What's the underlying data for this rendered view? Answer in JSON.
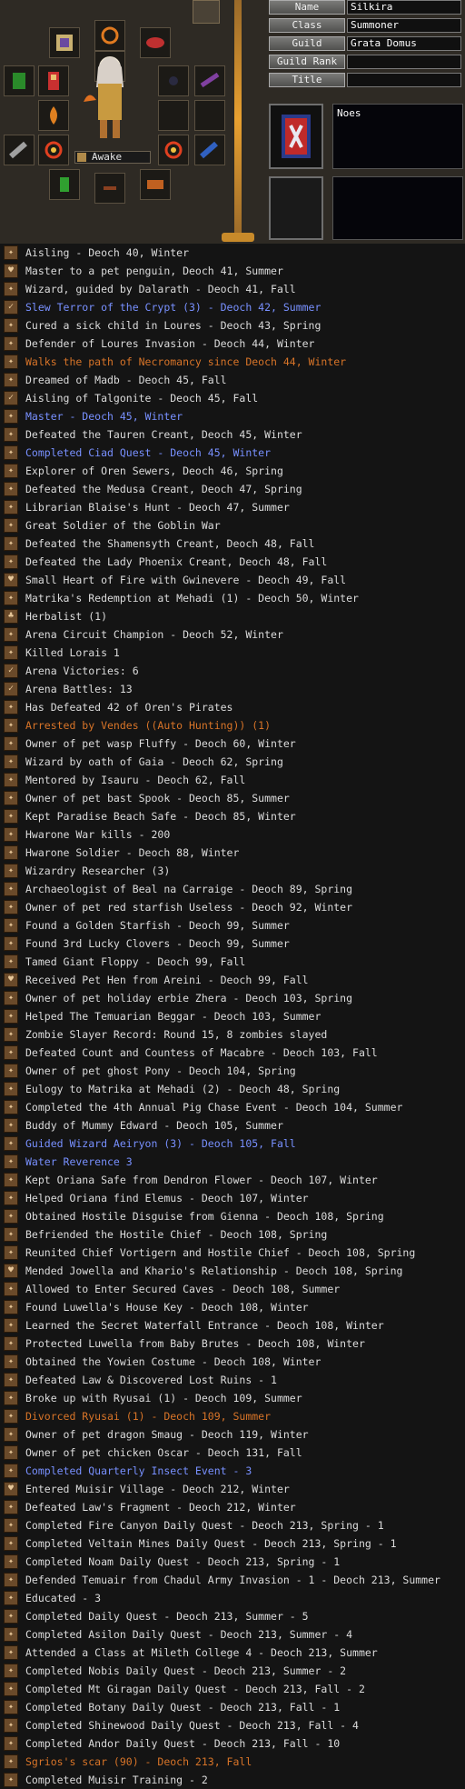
{
  "character": {
    "status_label": "Awake",
    "stats": [
      {
        "label": "Name",
        "value": "Silkira"
      },
      {
        "label": "Class",
        "value": "Summoner"
      },
      {
        "label": "Guild",
        "value": "Grata Domus"
      },
      {
        "label": "Guild Rank",
        "value": ""
      },
      {
        "label": "Title",
        "value": ""
      }
    ],
    "description": "Noes"
  },
  "colors": {
    "normal": "#dcdcdc",
    "blue": "#7890ff",
    "orange": "#d87428"
  },
  "legends": [
    {
      "icon": "legend-icon",
      "color": "normal",
      "text": "Aisling - Deoch 40, Winter"
    },
    {
      "icon": "heart-icon",
      "color": "normal",
      "text": "Master to a pet penguin, Deoch 41, Summer"
    },
    {
      "icon": "legend-icon",
      "color": "normal",
      "text": "Wizard, guided by Dalarath - Deoch 41, Fall"
    },
    {
      "icon": "check-icon",
      "color": "blue",
      "text": "Slew Terror of the Crypt (3) - Deoch 42, Summer"
    },
    {
      "icon": "legend-icon",
      "color": "normal",
      "text": "Cured a sick child in Loures - Deoch 43, Spring"
    },
    {
      "icon": "legend-icon",
      "color": "normal",
      "text": "Defender of Loures Invasion - Deoch 44, Winter"
    },
    {
      "icon": "legend-icon",
      "color": "orange",
      "text": "Walks the path of Necromancy since Deoch 44, Winter"
    },
    {
      "icon": "legend-icon",
      "color": "normal",
      "text": "Dreamed of Madb - Deoch 45, Fall"
    },
    {
      "icon": "check-icon",
      "color": "normal",
      "text": "Aisling of Talgonite - Deoch 45, Fall"
    },
    {
      "icon": "legend-icon",
      "color": "blue",
      "text": "Master - Deoch 45, Winter"
    },
    {
      "icon": "legend-icon",
      "color": "normal",
      "text": "Defeated the Tauren Creant, Deoch 45, Winter"
    },
    {
      "icon": "legend-icon",
      "color": "blue",
      "text": "Completed Ciad Quest - Deoch 45, Winter"
    },
    {
      "icon": "legend-icon",
      "color": "normal",
      "text": "Explorer of Oren Sewers, Deoch 46, Spring"
    },
    {
      "icon": "legend-icon",
      "color": "normal",
      "text": "Defeated the Medusa Creant, Deoch 47, Spring"
    },
    {
      "icon": "legend-icon",
      "color": "normal",
      "text": "Librarian Blaise's Hunt - Deoch 47, Summer"
    },
    {
      "icon": "legend-icon",
      "color": "normal",
      "text": "Great Soldier of the Goblin War"
    },
    {
      "icon": "legend-icon",
      "color": "normal",
      "text": "Defeated the Shamensyth Creant, Deoch 48, Fall"
    },
    {
      "icon": "legend-icon",
      "color": "normal",
      "text": "Defeated the Lady Phoenix Creant, Deoch 48, Fall"
    },
    {
      "icon": "heart-icon",
      "color": "normal",
      "text": "Small Heart of Fire with Gwinevere - Deoch 49, Fall"
    },
    {
      "icon": "legend-icon",
      "color": "normal",
      "text": "Matrika's Redemption at Mehadi (1) - Deoch 50, Winter"
    },
    {
      "icon": "herb-icon",
      "color": "normal",
      "text": "Herbalist (1)"
    },
    {
      "icon": "legend-icon",
      "color": "normal",
      "text": "Arena Circuit Champion - Deoch 52, Winter"
    },
    {
      "icon": "legend-icon",
      "color": "normal",
      "text": "Killed Lorais 1"
    },
    {
      "icon": "check-icon",
      "color": "normal",
      "text": "Arena Victories: 6"
    },
    {
      "icon": "check-icon",
      "color": "normal",
      "text": "Arena Battles: 13"
    },
    {
      "icon": "legend-icon",
      "color": "normal",
      "text": "Has Defeated 42 of Oren's Pirates"
    },
    {
      "icon": "legend-icon",
      "color": "orange",
      "text": "Arrested by Vendes ((Auto Hunting)) (1)"
    },
    {
      "icon": "legend-icon",
      "color": "normal",
      "text": "Owner of pet wasp Fluffy - Deoch 60, Winter"
    },
    {
      "icon": "legend-icon",
      "color": "normal",
      "text": "Wizard by oath of Gaia - Deoch 62, Spring"
    },
    {
      "icon": "legend-icon",
      "color": "normal",
      "text": "Mentored by Isauru - Deoch 62, Fall"
    },
    {
      "icon": "legend-icon",
      "color": "normal",
      "text": "Owner of pet bast Spook - Deoch 85, Summer"
    },
    {
      "icon": "legend-icon",
      "color": "normal",
      "text": "Kept Paradise Beach Safe - Deoch 85, Winter"
    },
    {
      "icon": "legend-icon",
      "color": "normal",
      "text": "Hwarone War kills - 200"
    },
    {
      "icon": "legend-icon",
      "color": "normal",
      "text": "Hwarone Soldier - Deoch 88, Winter"
    },
    {
      "icon": "legend-icon",
      "color": "normal",
      "text": "Wizardry Researcher (3)"
    },
    {
      "icon": "legend-icon",
      "color": "normal",
      "text": "Archaeologist of Beal na Carraige - Deoch 89, Spring"
    },
    {
      "icon": "legend-icon",
      "color": "normal",
      "text": "Owner of pet red starfish Useless - Deoch 92, Winter"
    },
    {
      "icon": "legend-icon",
      "color": "normal",
      "text": "Found a Golden Starfish - Deoch 99, Summer"
    },
    {
      "icon": "legend-icon",
      "color": "normal",
      "text": "Found 3rd Lucky Clovers - Deoch 99, Summer"
    },
    {
      "icon": "legend-icon",
      "color": "normal",
      "text": "Tamed Giant Floppy - Deoch 99, Fall"
    },
    {
      "icon": "heart-icon",
      "color": "normal",
      "text": "Received Pet Hen from Areini - Deoch 99, Fall"
    },
    {
      "icon": "legend-icon",
      "color": "normal",
      "text": "Owner of pet holiday erbie Zhera - Deoch 103, Spring"
    },
    {
      "icon": "legend-icon",
      "color": "normal",
      "text": "Helped The Temuarian Beggar - Deoch 103, Summer"
    },
    {
      "icon": "legend-icon",
      "color": "normal",
      "text": "Zombie Slayer Record: Round 15, 8 zombies slayed"
    },
    {
      "icon": "legend-icon",
      "color": "normal",
      "text": "Defeated Count and Countess of Macabre - Deoch 103, Fall"
    },
    {
      "icon": "legend-icon",
      "color": "normal",
      "text": "Owner of pet ghost Pony - Deoch 104, Spring"
    },
    {
      "icon": "legend-icon",
      "color": "normal",
      "text": "Eulogy to Matrika at Mehadi (2) - Deoch 48, Spring"
    },
    {
      "icon": "legend-icon",
      "color": "normal",
      "text": "Completed the 4th Annual Pig Chase Event - Deoch 104, Summer"
    },
    {
      "icon": "legend-icon",
      "color": "normal",
      "text": "Buddy of Mummy Edward - Deoch 105, Summer"
    },
    {
      "icon": "legend-icon",
      "color": "blue",
      "text": "Guided Wizard Aeiryon (3) - Deoch 105, Fall"
    },
    {
      "icon": "legend-icon",
      "color": "blue",
      "text": "Water Reverence 3"
    },
    {
      "icon": "legend-icon",
      "color": "normal",
      "text": "Kept Oriana Safe from Dendron Flower - Deoch 107, Winter"
    },
    {
      "icon": "legend-icon",
      "color": "normal",
      "text": "Helped Oriana find Elemus - Deoch 107, Winter"
    },
    {
      "icon": "legend-icon",
      "color": "normal",
      "text": "Obtained Hostile Disguise from Gienna - Deoch 108, Spring"
    },
    {
      "icon": "legend-icon",
      "color": "normal",
      "text": "Befriended the Hostile Chief - Deoch 108, Spring"
    },
    {
      "icon": "legend-icon",
      "color": "normal",
      "text": "Reunited Chief Vortigern and Hostile Chief - Deoch 108, Spring"
    },
    {
      "icon": "heart-icon",
      "color": "normal",
      "text": "Mended Jowella and Khario's Relationship - Deoch 108, Spring"
    },
    {
      "icon": "legend-icon",
      "color": "normal",
      "text": "Allowed to Enter Secured Caves - Deoch 108, Summer"
    },
    {
      "icon": "legend-icon",
      "color": "normal",
      "text": "Found Luwella's House Key - Deoch 108, Winter"
    },
    {
      "icon": "legend-icon",
      "color": "normal",
      "text": "Learned the Secret Waterfall Entrance - Deoch 108, Winter"
    },
    {
      "icon": "legend-icon",
      "color": "normal",
      "text": "Protected Luwella from Baby Brutes - Deoch 108, Winter"
    },
    {
      "icon": "legend-icon",
      "color": "normal",
      "text": "Obtained the Yowien Costume - Deoch 108, Winter"
    },
    {
      "icon": "legend-icon",
      "color": "normal",
      "text": "Defeated Law & Discovered Lost Ruins - 1"
    },
    {
      "icon": "legend-icon",
      "color": "normal",
      "text": "Broke up with Ryusai (1) - Deoch 109, Summer"
    },
    {
      "icon": "legend-icon",
      "color": "orange",
      "text": "Divorced Ryusai (1) - Deoch 109, Summer"
    },
    {
      "icon": "legend-icon",
      "color": "normal",
      "text": "Owner of pet dragon Smaug - Deoch 119, Winter"
    },
    {
      "icon": "legend-icon",
      "color": "normal",
      "text": "Owner of pet chicken Oscar - Deoch 131, Fall"
    },
    {
      "icon": "legend-icon",
      "color": "blue",
      "text": "Completed Quarterly Insect Event - 3"
    },
    {
      "icon": "heart-icon",
      "color": "normal",
      "text": "Entered Muisir Village - Deoch 212, Winter"
    },
    {
      "icon": "legend-icon",
      "color": "normal",
      "text": "Defeated Law's Fragment - Deoch 212, Winter"
    },
    {
      "icon": "legend-icon",
      "color": "normal",
      "text": "Completed Fire Canyon Daily Quest - Deoch 213, Spring - 1"
    },
    {
      "icon": "legend-icon",
      "color": "normal",
      "text": "Completed Veltain Mines Daily Quest - Deoch 213, Spring - 1"
    },
    {
      "icon": "legend-icon",
      "color": "normal",
      "text": "Completed Noam Daily Quest - Deoch 213, Spring - 1"
    },
    {
      "icon": "legend-icon",
      "color": "normal",
      "text": "Defended Temuair from Chadul Army Invasion - 1 - Deoch 213, Summer"
    },
    {
      "icon": "legend-icon",
      "color": "normal",
      "text": "Educated - 3"
    },
    {
      "icon": "legend-icon",
      "color": "normal",
      "text": "Completed Daily Quest - Deoch 213, Summer - 5"
    },
    {
      "icon": "legend-icon",
      "color": "normal",
      "text": "Completed Asilon Daily Quest - Deoch 213, Summer - 4"
    },
    {
      "icon": "legend-icon",
      "color": "normal",
      "text": "Attended a Class at Mileth College 4 - Deoch 213, Summer"
    },
    {
      "icon": "legend-icon",
      "color": "normal",
      "text": "Completed Nobis Daily Quest - Deoch 213, Summer - 2"
    },
    {
      "icon": "legend-icon",
      "color": "normal",
      "text": "Completed Mt Giragan Daily Quest - Deoch 213, Fall - 2"
    },
    {
      "icon": "legend-icon",
      "color": "normal",
      "text": "Completed Botany Daily Quest - Deoch 213, Fall - 1"
    },
    {
      "icon": "legend-icon",
      "color": "normal",
      "text": "Completed Shinewood Daily Quest - Deoch 213, Fall - 4"
    },
    {
      "icon": "legend-icon",
      "color": "normal",
      "text": "Completed Andor Daily Quest - Deoch 213, Fall - 10"
    },
    {
      "icon": "legend-icon",
      "color": "orange",
      "text": "Sgrios's scar (90) - Deoch 213, Fall"
    },
    {
      "icon": "legend-icon",
      "color": "normal",
      "text": "Completed Muisir Training - 2"
    }
  ]
}
